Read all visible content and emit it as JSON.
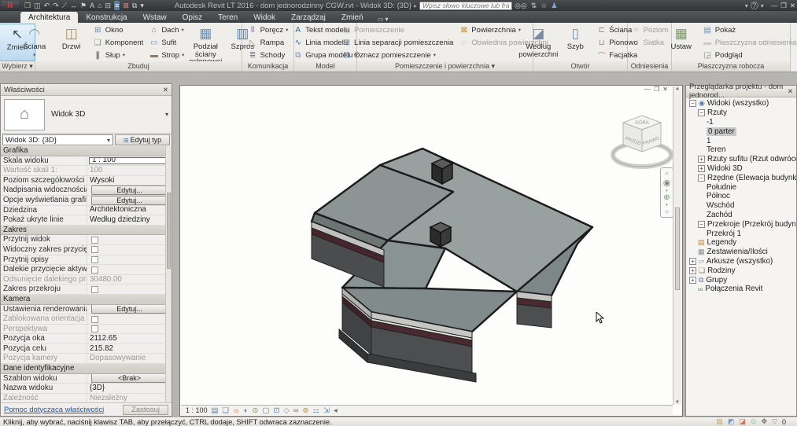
{
  "titlebar": {
    "title": "Autodesk Revit LT 2016 - dom jednorodzinny CGW.rvt - Widok 3D: {3D}",
    "search_placeholder": "Wpisz słowo kluczowe lub frazę",
    "qat_icons": [
      "open-icon",
      "save-icon",
      "undo-icon",
      "redo-icon",
      "measure-icon",
      "aligned-dimension-icon",
      "tag-icon",
      "text-icon",
      "default-3d-view-icon",
      "section-icon",
      "thin-lines-icon",
      "close-hidden-windows-icon",
      "switch-windows-icon",
      "customize-qat-icon"
    ],
    "right_icons": [
      "binoculars-icon",
      "exchange-apps-icon",
      "favorites-icon",
      "sign-in-icon"
    ],
    "help_label": "?"
  },
  "tabs": {
    "items": [
      {
        "label": "Architektura",
        "active": true
      },
      {
        "label": "Konstrukcja"
      },
      {
        "label": "Wstaw"
      },
      {
        "label": "Opisz"
      },
      {
        "label": "Teren"
      },
      {
        "label": "Widok"
      },
      {
        "label": "Zarządzaj"
      },
      {
        "label": "Zmień"
      }
    ]
  },
  "ribbon": {
    "panels": [
      {
        "label": "Wybierz",
        "dropdown": true,
        "columns": [
          [
            {
              "label": "Zmień",
              "size": "large",
              "icon": "modify-cursor-icon",
              "active": true
            }
          ]
        ]
      },
      {
        "label": "Zbuduj",
        "columns": [
          [
            {
              "label": "Ściana",
              "size": "large",
              "icon": "wall-icon",
              "dropdown": true
            }
          ],
          [
            {
              "label": "Drzwi",
              "size": "large",
              "icon": "door-icon"
            }
          ],
          [
            {
              "label": "Okno",
              "icon": "window-icon"
            },
            {
              "label": "Komponent",
              "icon": "component-icon"
            },
            {
              "label": "Słup",
              "icon": "column-icon",
              "dropdown": true
            }
          ],
          [
            {
              "label": "Dach",
              "icon": "roof-icon",
              "dropdown": true
            },
            {
              "label": "Sufit",
              "icon": "ceiling-icon"
            },
            {
              "label": "Strop",
              "icon": "floor-icon",
              "dropdown": true
            }
          ],
          [
            {
              "label": "Podział ściany osłonowej",
              "size": "large",
              "icon": "curtain-grid-icon"
            }
          ],
          [
            {
              "label": "Szpros",
              "size": "large",
              "icon": "mullion-icon"
            }
          ]
        ]
      },
      {
        "label": "Komunikacja",
        "columns": [
          [
            {
              "label": "Poręcz",
              "icon": "railing-icon",
              "dropdown": true
            },
            {
              "label": "Rampa",
              "icon": "ramp-icon"
            },
            {
              "label": "Schody",
              "icon": "stairs-icon"
            }
          ]
        ]
      },
      {
        "label": "Model",
        "columns": [
          [
            {
              "label": "Tekst modelu",
              "icon": "model-text-icon"
            },
            {
              "label": "Linia modelu",
              "icon": "model-line-icon"
            },
            {
              "label": "Grupa modelu",
              "icon": "model-group-icon",
              "dropdown": true
            }
          ]
        ]
      },
      {
        "label": "Pomieszczenie i powierzchnia",
        "dropdown": true,
        "columns": [
          [
            {
              "label": "Pomieszczenie",
              "icon": "room-icon",
              "disabled": true
            },
            {
              "label": "Linia separacji pomieszczenia",
              "icon": "room-separation-icon"
            },
            {
              "label": "Oznacz pomieszczenie",
              "icon": "tag-room-icon",
              "dropdown": true
            }
          ],
          [
            {
              "label": "Powierzchnia",
              "icon": "area-icon",
              "dropdown": true
            },
            {
              "label": "Obwiednia powierzchni",
              "icon": "area-boundary-icon",
              "disabled": true
            }
          ]
        ]
      },
      {
        "label": "Otwór",
        "columns": [
          [
            {
              "label": "Według powierzchni",
              "size": "large",
              "icon": "opening-by-face-icon"
            }
          ],
          [
            {
              "label": "Szyb",
              "size": "large",
              "icon": "shaft-opening-icon"
            }
          ],
          [
            {
              "label": "Ściana",
              "icon": "wall-opening-icon"
            },
            {
              "label": "Pionowo",
              "icon": "vertical-opening-icon"
            },
            {
              "label": "Facjatka",
              "icon": "dormer-opening-icon"
            }
          ]
        ]
      },
      {
        "label": "Odniesienia",
        "columns": [
          [
            {
              "label": "Poziom",
              "icon": "level-icon",
              "disabled": true
            },
            {
              "label": "Siatka",
              "icon": "grid-icon",
              "disabled": true
            }
          ]
        ]
      },
      {
        "label": "Płaszczyzna robocza",
        "columns": [
          [
            {
              "label": "Ustaw",
              "size": "large",
              "icon": "set-workplane-icon"
            }
          ],
          [
            {
              "label": "Pokaż",
              "icon": "show-workplane-icon"
            },
            {
              "label": "Płaszczyzna odniesienia",
              "icon": "reference-plane-icon",
              "disabled": true
            },
            {
              "label": "Podgląd",
              "icon": "workplane-viewer-icon"
            }
          ]
        ]
      }
    ]
  },
  "properties": {
    "header": "Właściwości",
    "type_label": "Widok 3D",
    "selector": "Widok 3D: {3D}",
    "edit_type": "Edytuj typ",
    "rows": [
      {
        "type": "section",
        "label": "Grafika"
      },
      {
        "type": "input",
        "label": "Skala widoku",
        "value": "1 : 100"
      },
      {
        "type": "text",
        "label": "Wartość skali   1:",
        "value": "100",
        "disabled": true
      },
      {
        "type": "text",
        "label": "Poziom szczegółowości",
        "value": "Wysoki"
      },
      {
        "type": "button",
        "label": "Nadpisania widoczności/g...",
        "value": "Edytuj..."
      },
      {
        "type": "button",
        "label": "Opcje wyświetlania grafiki",
        "value": "Edytuj..."
      },
      {
        "type": "text",
        "label": "Dziedzina",
        "value": "Architektoniczna"
      },
      {
        "type": "text",
        "label": "Pokaż ukryte linie",
        "value": "Według dziedziny"
      },
      {
        "type": "section",
        "label": "Zakres"
      },
      {
        "type": "check",
        "label": "Przytnij widok"
      },
      {
        "type": "check",
        "label": "Widoczny zakres przycięcia"
      },
      {
        "type": "check",
        "label": "Przytnij opisy"
      },
      {
        "type": "check",
        "label": "Dalekie przycięcie aktywne"
      },
      {
        "type": "text",
        "label": "Odsunięcie dalekiego przy...",
        "value": "30480.00",
        "disabled": true
      },
      {
        "type": "check",
        "label": "Zakres przekroju"
      },
      {
        "type": "section",
        "label": "Kamera"
      },
      {
        "type": "button",
        "label": "Ustawienia renderowania",
        "value": "Edytuj..."
      },
      {
        "type": "check",
        "label": "Zablokowana orientacja",
        "disabled": true
      },
      {
        "type": "check",
        "label": "Perspektywa",
        "disabled": true
      },
      {
        "type": "text",
        "label": "Pozycja oka",
        "value": "2112.65"
      },
      {
        "type": "text",
        "label": "Pozycja celu",
        "value": "215.82"
      },
      {
        "type": "text",
        "label": "Pozycja kamery",
        "value": "Dopasowywanie",
        "disabled": true
      },
      {
        "type": "section",
        "label": "Dane identyfikacyjne"
      },
      {
        "type": "button",
        "label": "Szablon widoku",
        "value": "<Brak>"
      },
      {
        "type": "text",
        "label": "Nazwa widoku",
        "value": "{3D}"
      },
      {
        "type": "text",
        "label": "Zależność",
        "value": "Niezależny",
        "disabled": true,
        "dropdown": true
      }
    ],
    "help_link": "Pomoc dotycząca właściwości",
    "apply_label": "Zastosuj"
  },
  "browser": {
    "header": "Przeglądarka projektu - dom jednorod...",
    "items": [
      {
        "label": "Widoki (wszystko)",
        "indent": 0,
        "expander": "minus",
        "icon": "views-icon"
      },
      {
        "label": "Rzuty",
        "indent": 1,
        "expander": "minus"
      },
      {
        "label": "-1",
        "indent": 2
      },
      {
        "label": "0 parter",
        "indent": 2,
        "selected": true
      },
      {
        "label": "1",
        "indent": 2
      },
      {
        "label": "Teren",
        "indent": 2
      },
      {
        "label": "Rzuty sufitu (Rzut odwrócony)",
        "indent": 1,
        "expander": "plus"
      },
      {
        "label": "Widoki 3D",
        "indent": 1,
        "expander": "plus"
      },
      {
        "label": "Rzędne (Elewacja budynku)",
        "indent": 1,
        "expander": "minus"
      },
      {
        "label": "Południe",
        "indent": 2
      },
      {
        "label": "Północ",
        "indent": 2
      },
      {
        "label": "Wschód",
        "indent": 2
      },
      {
        "label": "Zachód",
        "indent": 2
      },
      {
        "label": "Przekroje (Przekrój budynku)",
        "indent": 1,
        "expander": "minus"
      },
      {
        "label": "Przekrój 1",
        "indent": 2
      },
      {
        "label": "Legendy",
        "indent": 1,
        "icon": "legend-icon"
      },
      {
        "label": "Zestawienia/Ilości",
        "indent": 1,
        "icon": "schedule-icon"
      },
      {
        "label": "Arkusze (wszystko)",
        "indent": 0,
        "expander": "plus",
        "icon": "sheet-icon"
      },
      {
        "label": "Rodziny",
        "indent": 0,
        "expander": "plus",
        "icon": "family-icon"
      },
      {
        "label": "Grupy",
        "indent": 0,
        "expander": "plus",
        "icon": "group-icon"
      },
      {
        "label": "Połączenia Revit",
        "indent": 1,
        "icon": "revit-link-icon"
      }
    ]
  },
  "canvas": {
    "scale_label": "1 : 100",
    "view_controls": [
      "detail-level-icon",
      "visual-style-icon",
      "sun-path-icon",
      "shadows-icon",
      "rendering-dialog-icon",
      "crop-view-icon",
      "show-crop-icon",
      "lock-3d-view-icon",
      "hide-isolate-icon",
      "reveal-hidden-icon",
      "temp-view-properties-icon",
      "displaced-elements-icon",
      "collapse-bar-icon"
    ],
    "viewcube": {
      "top": "GÓRA",
      "front": "PRZÓD",
      "right": "PRAWO"
    }
  },
  "statusbar": {
    "hint": "Kliknij, aby wybrać, naciśnij klawisz TAB, aby przełączyć, CTRL dodaje, SHIFT odwraca zaznaczenie.",
    "icons": [
      "link-select-icon",
      "underlay-select-icon",
      "pinned-select-icon",
      "face-select-icon",
      "drag-select-icon"
    ],
    "filter_count": "0"
  }
}
